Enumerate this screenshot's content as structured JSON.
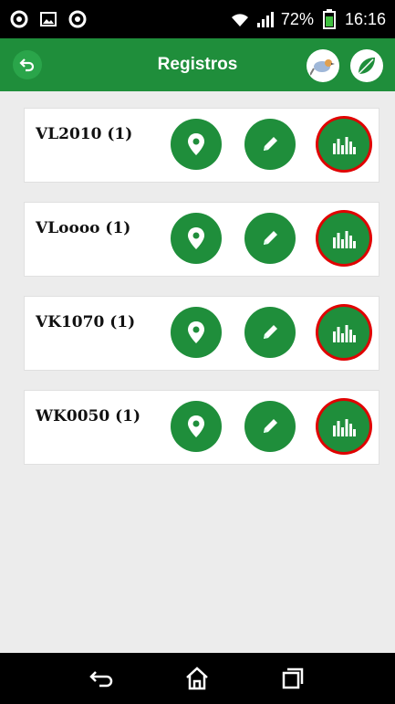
{
  "status_bar": {
    "battery": "72%",
    "time": "16:16"
  },
  "app_bar": {
    "title": "Registros"
  },
  "records": [
    {
      "label": "VL2010 (1)"
    },
    {
      "label": "VLoooo (1)"
    },
    {
      "label": "VK1070 (1)"
    },
    {
      "label": "WK0050 (1)"
    }
  ],
  "colors": {
    "primary_green": "#1f8e3b",
    "highlight_red": "#e00000"
  }
}
